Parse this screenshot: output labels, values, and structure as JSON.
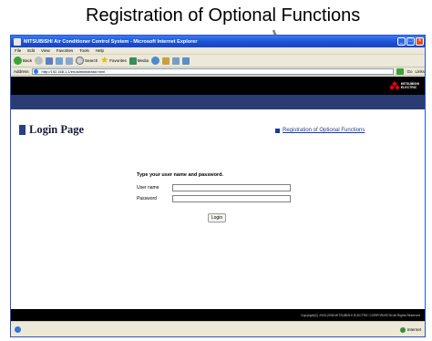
{
  "callout": {
    "title": "Registration of Optional Functions"
  },
  "window": {
    "title": "MITSUBISHI Air Conditioner Control System - Microsoft Internet Explorer",
    "menu": [
      "File",
      "Edit",
      "View",
      "Favorites",
      "Tools",
      "Help"
    ],
    "toolbar": {
      "back": "Back",
      "search": "Search",
      "favorites": "Favorites",
      "media": "Media"
    },
    "address": {
      "label": "Address",
      "url": "http://192.168.1.1/en/administrator.html",
      "go": "Go",
      "links": "Links"
    }
  },
  "brand": {
    "logo_line1": "MITSUBISHI",
    "logo_line2": "ELECTRIC"
  },
  "page": {
    "heading": "Login Page",
    "reg_link": "Registration of Optional Functions",
    "prompt": "Type your user name and password.",
    "username_label": "User name",
    "password_label": "Password",
    "username_value": "",
    "password_value": "",
    "login_button": "Login",
    "copyright": "Copyright(C) 2003-2006 MITSUBISHI ELECTRIC CORPORATION All Rights Reserved"
  },
  "status": {
    "zone": "Internet"
  },
  "colors": {
    "nav_band": "#2b3c74",
    "brand_red": "#e60012",
    "link": "#1a3a9a"
  }
}
